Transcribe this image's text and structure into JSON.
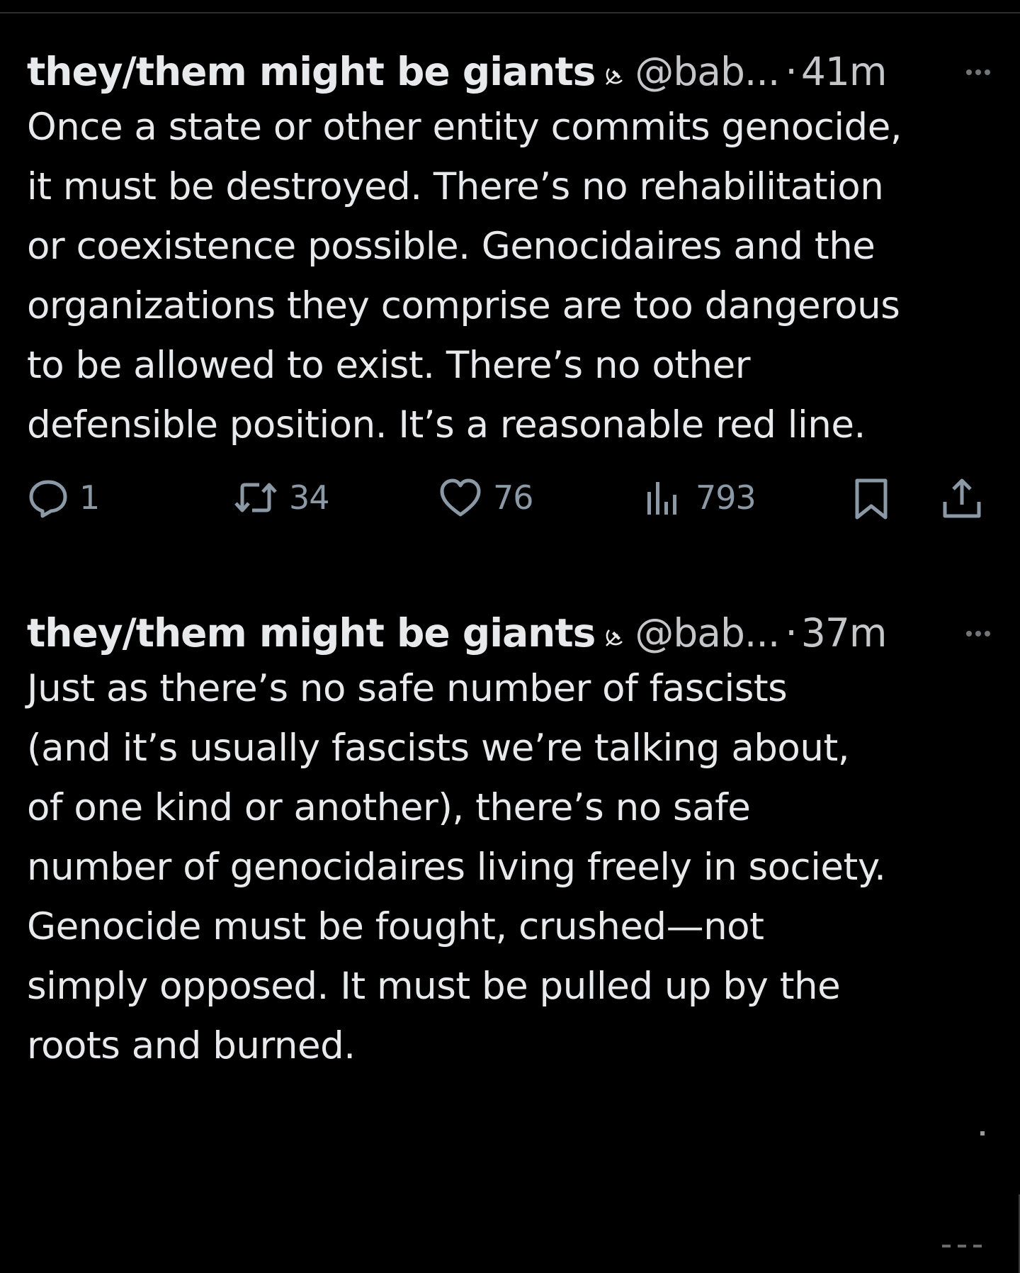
{
  "theme": {
    "background": "#000000",
    "text_primary": "#e7e9ea",
    "text_secondary": "#c4c6c8",
    "icon_color": "#8b98a5"
  },
  "tweets": [
    {
      "display_name": "they/them might be giants",
      "badge_icon": "hammer-sickle-icon",
      "handle": "@bab...",
      "separator": "·",
      "timestamp": "41m",
      "text_lines": [
        "Once a state or other entity commits genocide,",
        "it must be destroyed. There’s no rehabilitation",
        "or coexistence possible. Genocidaires and the",
        "organizations they comprise are too dangerous",
        "to be allowed to exist. There’s no other",
        "defensible position. It’s a reasonable red line."
      ],
      "actions": {
        "replies": "1",
        "reposts": "34",
        "likes": "76",
        "views": "793"
      }
    },
    {
      "display_name": "they/them might be giants",
      "badge_icon": "hammer-sickle-icon",
      "handle": "@bab...",
      "separator": "·",
      "timestamp": "37m",
      "text_lines": [
        "Just as there’s no safe number of fascists",
        "(and it’s usually fascists we’re talking about,",
        "of one kind or another), there’s no safe",
        "number of genocidaires living freely in society.",
        "Genocide must be fought, crushed—not",
        "simply opposed. It must be pulled up by the",
        "roots and burned."
      ]
    }
  ]
}
